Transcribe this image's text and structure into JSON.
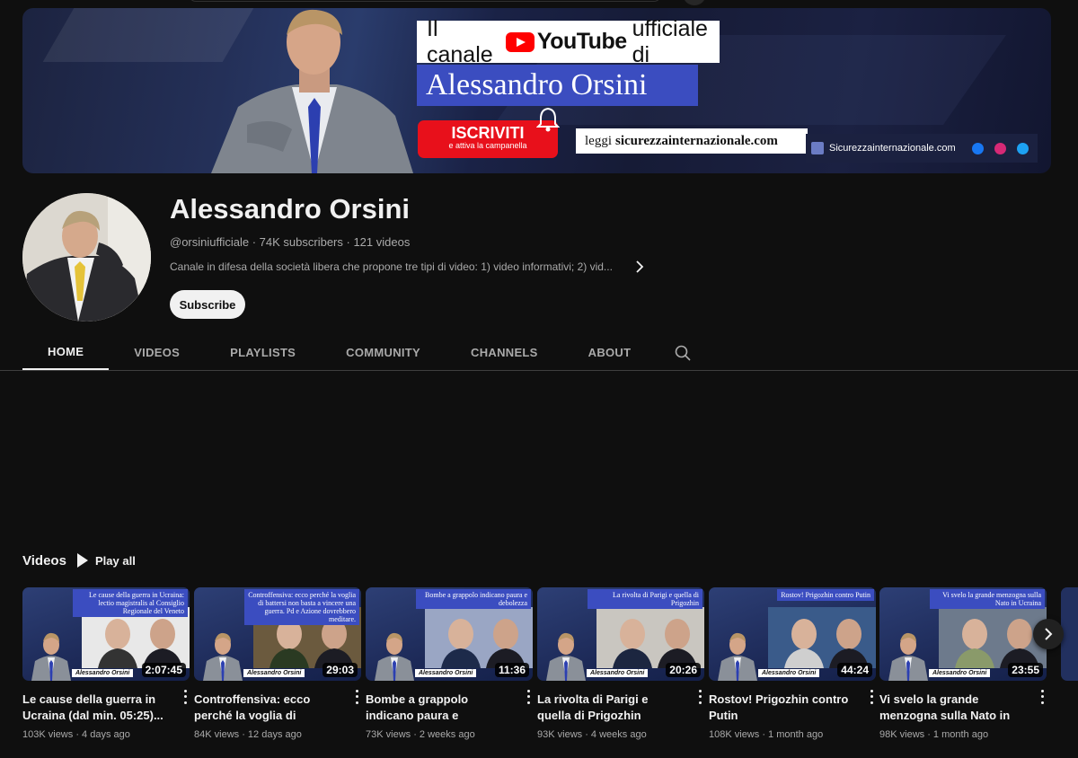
{
  "banner": {
    "title_prefix": "Il canale",
    "yt_word": "YouTube",
    "title_suffix": "ufficiale di",
    "name": "Alessandro Orsini",
    "subscribe_big": "ISCRIVITI",
    "subscribe_small": "e attiva la campanella",
    "read_prefix": "leggi",
    "read_site": "sicurezzainternazionale.com",
    "site_name": "Sicurezzainternazionale.com"
  },
  "channel": {
    "name": "Alessandro Orsini",
    "handle": "@orsiniufficiale",
    "subscribers": "74K subscribers",
    "videos": "121 videos",
    "description": "Canale in difesa della società libera che propone tre tipi di video: 1) video informativi; 2) vid...",
    "subscribe_label": "Subscribe"
  },
  "tabs": [
    {
      "label": "HOME",
      "active": true
    },
    {
      "label": "VIDEOS"
    },
    {
      "label": "PLAYLISTS"
    },
    {
      "label": "COMMUNITY"
    },
    {
      "label": "CHANNELS"
    },
    {
      "label": "ABOUT"
    }
  ],
  "shelf": {
    "title": "Videos",
    "play_all": "Play all"
  },
  "videos": [
    {
      "caption": "Le cause della guerra in Ucraina: lectio magistralis al Consiglio Regionale del Veneto",
      "duration": "2:07:45",
      "title": "Le cause della guerra in Ucraina (dal min. 05:25)...",
      "views": "103K views",
      "age": "4 days ago"
    },
    {
      "caption": "Controffensiva: ecco perché la voglia di battersi non basta a vincere una guerra. Pd e Azione dovrebbero meditare.",
      "duration": "29:03",
      "title": "Controffensiva: ecco perché la voglia di battersi non bas...",
      "views": "84K views",
      "age": "12 days ago"
    },
    {
      "caption": "Bombe a grappolo indicano paura e debolezza",
      "duration": "11:36",
      "title": "Bombe a grappolo indicano paura e debolezza",
      "views": "73K views",
      "age": "2 weeks ago"
    },
    {
      "caption": "La rivolta di Parigi e quella di Prigozhin",
      "duration": "20:26",
      "title": "La rivolta di Parigi e quella di Prigozhin",
      "views": "93K views",
      "age": "4 weeks ago"
    },
    {
      "caption": "Rostov! Prigozhin contro Putin",
      "duration": "44:24",
      "title": "Rostov! Prigozhin contro Putin",
      "views": "108K views",
      "age": "1 month ago"
    },
    {
      "caption": "Vi svelo la grande menzogna sulla Nato in Ucraina",
      "duration": "23:55",
      "title": "Vi svelo la grande menzogna sulla Nato in Ucraina",
      "views": "98K views",
      "age": "1 month ago"
    }
  ],
  "thumb_nameplate": "Alessandro Orsini",
  "meta_separator": " · ",
  "colors": {
    "background": "#0f0f0f",
    "banner_blue": "#3b4dc0",
    "youtube_red": "#ff0000",
    "subscribe_red": "#e8101b",
    "text_secondary": "#aaaaaa"
  },
  "icons": [
    "search-icon",
    "chevron-right-icon",
    "play-icon",
    "more-vert-icon",
    "bell-icon",
    "youtube-logo-icon"
  ]
}
